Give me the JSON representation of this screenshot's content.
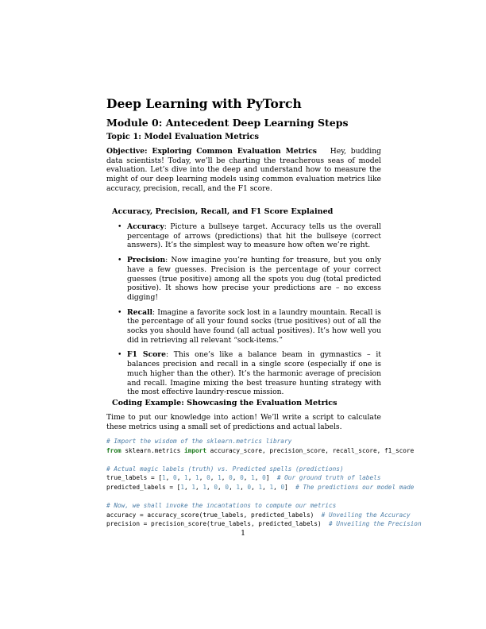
{
  "doc": {
    "title": "Deep Learning with PyTorch",
    "module": "Module 0: Antecedent Deep Learning Steps",
    "topic": "Topic 1: Model Evaluation Metrics",
    "objective_label": "Objective: Exploring Common Evaluation Metrics",
    "objective_text": "Hey, budding data scientists! Today, we’ll be charting the treacherous seas of model evaluation. Let’s dive into the deep and understand how to measure the might of our deep learning models using common evaluation metrics like accuracy, precision, recall, and the F1 score.",
    "section1": "Accuracy, Precision, Recall, and F1 Score Explained",
    "bullets": [
      {
        "term": "Accuracy",
        "text": ": Picture a bullseye target. Accuracy tells us the overall percentage of arrows (predictions) that hit the bullseye (correct answers). It’s the simplest way to measure how often we’re right."
      },
      {
        "term": "Precision",
        "text": ": Now imagine you’re hunting for treasure, but you only have a few guesses. Precision is the percentage of your correct guesses (true positive) among all the spots you dug (total predicted positive). It shows how precise your predictions are – no excess digging!"
      },
      {
        "term": "Recall",
        "text": ": Imagine a favorite sock lost in a laundry mountain. Recall is the percentage of all your found socks (true positives) out of all the socks you should have found (all actual positives). It’s how well you did in retrieving all relevant “sock-items.”"
      },
      {
        "term": "F1 Score",
        "text": ": This one’s like a balance beam in gymnastics – it balances precision and recall in a single score (especially if one is much higher than the other). It’s the harmonic average of precision and recall. Imagine mixing the best treasure hunting strategy with the most effective laundry-rescue mission."
      }
    ],
    "bullet_glyph": "•",
    "section2": "Coding Example: Showcasing the Evaluation Metrics",
    "intro": "Time to put our knowledge into action! We’ll write a script to calculate these metrics using a small set of predictions and actual labels.",
    "code": {
      "c1": "# Import the wisdom of the sklearn.metrics library",
      "l2a": "from",
      "l2b": " sklearn.metrics ",
      "l2c": "import",
      "l2d": " accuracy_score, precision_score, recall_score, f1_score",
      "c2": "# Actual magic labels (truth) vs. Predicted spells (predictions)",
      "true_prefix": "true_labels = [",
      "true_vals": [
        "1",
        "0",
        "1",
        "1",
        "0",
        "1",
        "0",
        "0",
        "1",
        "0"
      ],
      "true_comment": "# Our ground truth of labels",
      "pred_prefix": "predicted_labels = [",
      "pred_vals": [
        "1",
        "1",
        "1",
        "0",
        "0",
        "1",
        "0",
        "1",
        "1",
        "0"
      ],
      "pred_comment": "# The predictions our model made",
      "c3": "# Now, we shall invoke the incantations to compute our metrics",
      "acc_line": "accuracy = accuracy_score(true_labels, predicted_labels)",
      "acc_comment": "# Unveiling the Accuracy",
      "prec_line": "precision = precision_score(true_labels, predicted_labels)",
      "prec_comment": "# Unveiling the Precision"
    },
    "page_number": "1"
  }
}
